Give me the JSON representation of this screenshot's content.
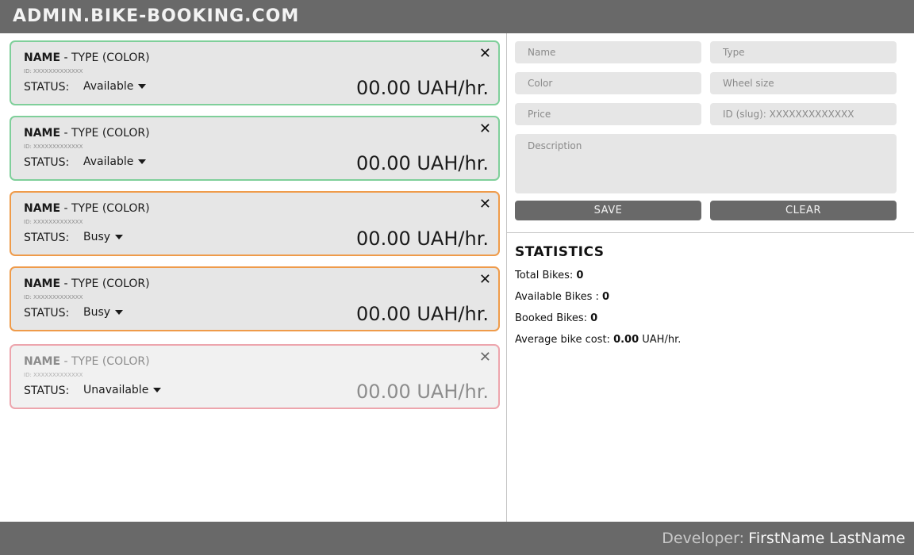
{
  "header": {
    "title": "ADMIN.BIKE-BOOKING.COM"
  },
  "bikes": [
    {
      "name": "NAME",
      "type": " - TYPE (COLOR)",
      "id": "ID: XXXXXXXXXXXXX",
      "status_label": "STATUS:",
      "status": "Available",
      "price": "00.00 UAH/hr.",
      "state": "available"
    },
    {
      "name": "NAME",
      "type": " - TYPE (COLOR)",
      "id": "ID: XXXXXXXXXXXXX",
      "status_label": "STATUS:",
      "status": "Available",
      "price": "00.00 UAH/hr.",
      "state": "available"
    },
    {
      "name": "NAME",
      "type": " - TYPE (COLOR)",
      "id": "ID: XXXXXXXXXXXXX",
      "status_label": "STATUS:",
      "status": "Busy",
      "price": "00.00 UAH/hr.",
      "state": "busy"
    },
    {
      "name": "NAME",
      "type": " - TYPE (COLOR)",
      "id": "ID: XXXXXXXXXXXXX",
      "status_label": "STATUS:",
      "status": "Busy",
      "price": "00.00 UAH/hr.",
      "state": "busy"
    },
    {
      "name": "NAME",
      "type": " - TYPE (COLOR)",
      "id": "ID: XXXXXXXXXXXXX",
      "status_label": "STATUS:",
      "status": "Unavailable",
      "price": "00.00 UAH/hr.",
      "state": "unavailable"
    }
  ],
  "card_close_glyph": "✕",
  "form": {
    "name_placeholder": "Name",
    "type_placeholder": "Type",
    "color_placeholder": "Color",
    "wheel_placeholder": "Wheel size",
    "price_placeholder": "Price",
    "id_placeholder": "ID (slug): XXXXXXXXXXXXX",
    "description_placeholder": "Description",
    "save_label": "SAVE",
    "clear_label": "CLEAR"
  },
  "stats": {
    "title": "STATISTICS",
    "total_label": "Total Bikes: ",
    "total_value": "0",
    "available_label": "Available Bikes : ",
    "available_value": "0",
    "booked_label": "Booked Bikes: ",
    "booked_value": "0",
    "avg_label": "Average bike cost: ",
    "avg_value": "0.00",
    "avg_unit": " UAH/hr."
  },
  "footer": {
    "developer_label": "Developer:",
    "developer_name": "FirstName LastName"
  },
  "colors": {
    "header_bg": "#696969",
    "available_border": "#7fcf9a",
    "busy_border": "#ef9b4a",
    "unavailable_border": "#eda5ad",
    "field_bg": "#e6e6e6",
    "button_bg": "#696969"
  }
}
